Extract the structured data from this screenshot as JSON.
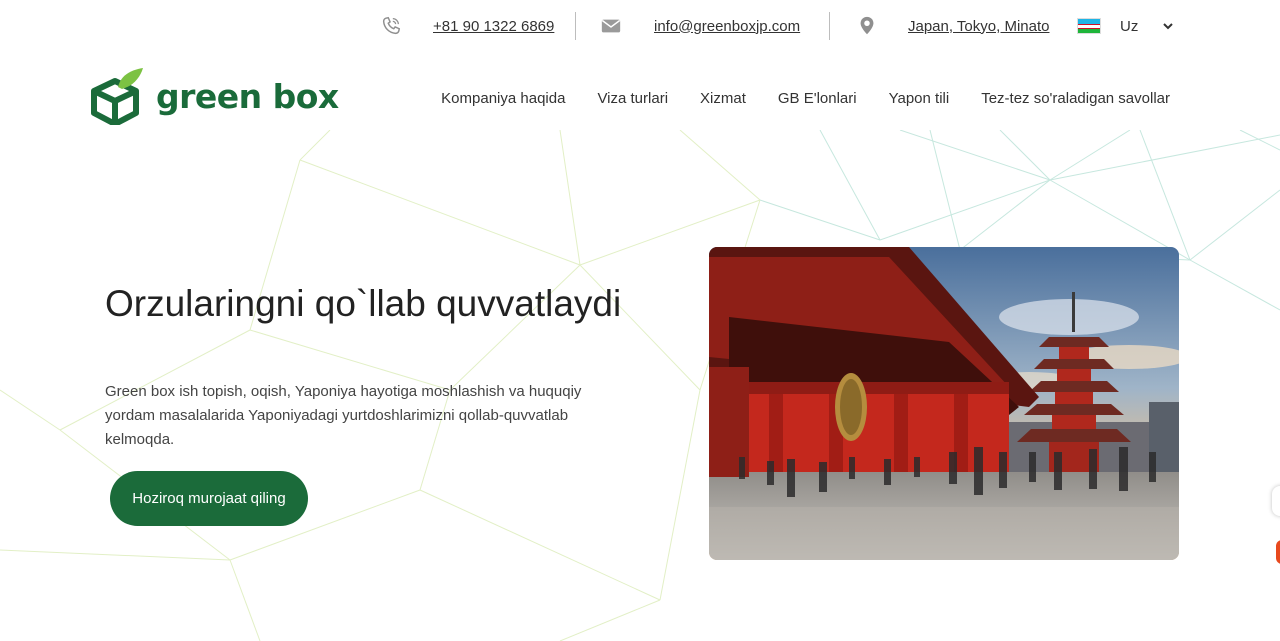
{
  "topbar": {
    "phone": "+81 90 1322 6869",
    "email": "info@greenboxjp.com",
    "address": "Japan, Tokyo, Minato",
    "language": "Uz",
    "icons": {
      "phone": "phone-icon",
      "email": "mail-icon",
      "location": "map-pin-icon",
      "flag": "uzbekistan-flag-icon",
      "dropdown": "chevron-down-icon"
    }
  },
  "brand": {
    "name": "green box",
    "color": "#1b6b3a",
    "accent": "#7cc243"
  },
  "nav": {
    "items": [
      {
        "label": "Kompaniya haqida"
      },
      {
        "label": "Viza turlari"
      },
      {
        "label": "Xizmat"
      },
      {
        "label": "GB E'lonlari"
      },
      {
        "label": "Yapon tili"
      },
      {
        "label": "Tez-tez so'raladigan savollar"
      }
    ]
  },
  "hero": {
    "title": "Orzularingni qo`llab quvvatlaydi",
    "subtitle": "Green box ish topish, oqish, Yaponiya hayotiga moshlashish va huquqiy yordam masalalarida Yaponiyadagi yurtdoshlarimizni qollab-quvvatlab kelmoqda.",
    "cta_label": "Hoziroq murojaat qiling",
    "image": "sensoji-temple-pagoda-photo"
  }
}
